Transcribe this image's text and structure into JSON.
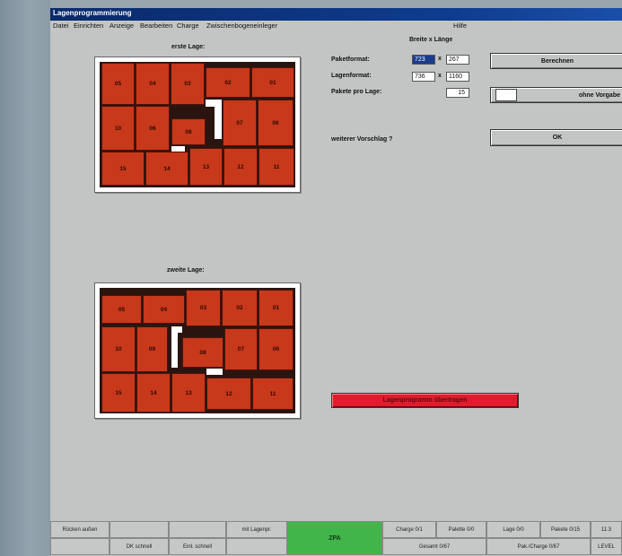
{
  "window": {
    "title": "Lagenprogrammierung"
  },
  "menu": [
    "Datei",
    "Einrichten",
    "Anzeige",
    "Bearbeiten",
    "Charge",
    "Zwischenbogeneinleger",
    "Hilfe"
  ],
  "layer1": {
    "title": "erste Lage:"
  },
  "layer2": {
    "title": "zweite Lage:"
  },
  "form": {
    "header": "Breite x Länge",
    "paket_label": "Paketformat:",
    "paket_w": "723",
    "paket_l": "267",
    "lagen_label": "Lagenformat:",
    "lagen_w": "736",
    "lagen_l": "1160",
    "pakete_label": "Pakete pro Lage:",
    "pakete_value": "15",
    "x": "x",
    "berechnen": "Berechnen",
    "ohne_vorgabe": "ohne Vorgabe",
    "weiterer": "weiterer Vorschlag ?",
    "ok": "OK",
    "uebertragen": "Lagenprogramm übertragen"
  },
  "status": {
    "r1": [
      "Rücken außen",
      "",
      "",
      "mit Lagenpr.",
      "ZPA",
      "Charge 0/1",
      "Palette 0/0",
      "Lage 0/0",
      "Pakete 0/15",
      "11:3"
    ],
    "r2": [
      "",
      "DK schnell",
      "Einl. schnell",
      "",
      "",
      "Gesamt 0/67",
      "",
      "Pak./Charge 0/67",
      "",
      "LEVEL"
    ]
  },
  "colors": {
    "box": "#c8381a",
    "title": "#0e3c8e",
    "action_red": "#e21b2e",
    "status_green": "#41b54a"
  }
}
